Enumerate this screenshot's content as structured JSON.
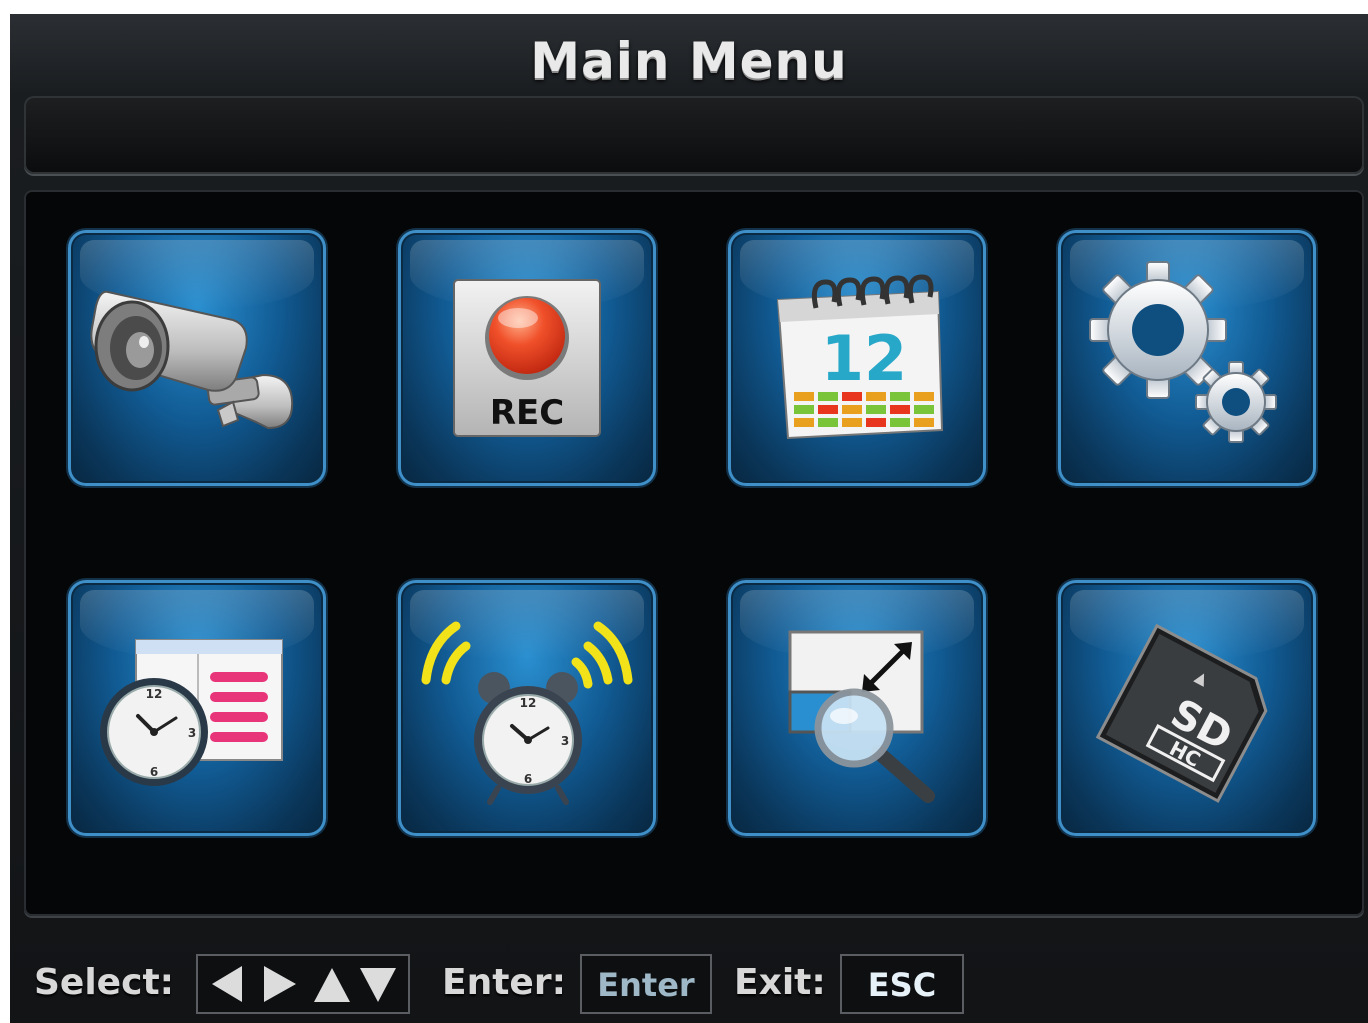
{
  "title": "Main Menu",
  "status_text": "",
  "tiles": [
    {
      "name": "camera-tile",
      "icon": "security-camera-icon"
    },
    {
      "name": "record-tile",
      "icon": "rec-button-icon",
      "label": "REC"
    },
    {
      "name": "calendar-tile",
      "icon": "calendar-icon",
      "label": "12"
    },
    {
      "name": "settings-tile",
      "icon": "gears-icon"
    },
    {
      "name": "schedule-tile",
      "icon": "clock-list-icon"
    },
    {
      "name": "alarm-tile",
      "icon": "alarm-clock-icon"
    },
    {
      "name": "zoom-tile",
      "icon": "magnifier-resize-icon"
    },
    {
      "name": "sd-card-tile",
      "icon": "sdhc-card-icon"
    }
  ],
  "footer": {
    "select_label": "Select:",
    "enter_label": "Enter:",
    "enter_key": "Enter",
    "exit_label": "Exit:",
    "exit_key": "ESC"
  },
  "colors": {
    "tile_blue": "#115b94",
    "rec_red": "#e8351e",
    "calendar_teal": "#28a8c8",
    "alarm_yellow": "#f2e21a",
    "list_pink": "#e8357a"
  }
}
